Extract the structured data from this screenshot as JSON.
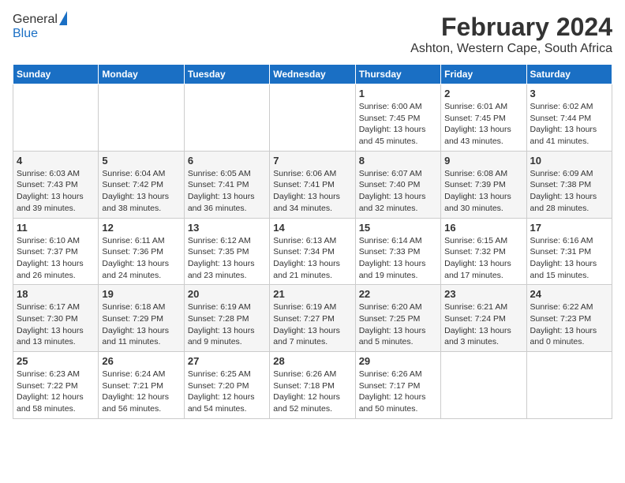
{
  "header": {
    "logo_line1": "General",
    "logo_line2": "Blue",
    "month": "February 2024",
    "location": "Ashton, Western Cape, South Africa"
  },
  "days_of_week": [
    "Sunday",
    "Monday",
    "Tuesday",
    "Wednesday",
    "Thursday",
    "Friday",
    "Saturday"
  ],
  "weeks": [
    [
      {
        "day": "",
        "info": ""
      },
      {
        "day": "",
        "info": ""
      },
      {
        "day": "",
        "info": ""
      },
      {
        "day": "",
        "info": ""
      },
      {
        "day": "1",
        "info": "Sunrise: 6:00 AM\nSunset: 7:45 PM\nDaylight: 13 hours\nand 45 minutes."
      },
      {
        "day": "2",
        "info": "Sunrise: 6:01 AM\nSunset: 7:45 PM\nDaylight: 13 hours\nand 43 minutes."
      },
      {
        "day": "3",
        "info": "Sunrise: 6:02 AM\nSunset: 7:44 PM\nDaylight: 13 hours\nand 41 minutes."
      }
    ],
    [
      {
        "day": "4",
        "info": "Sunrise: 6:03 AM\nSunset: 7:43 PM\nDaylight: 13 hours\nand 39 minutes."
      },
      {
        "day": "5",
        "info": "Sunrise: 6:04 AM\nSunset: 7:42 PM\nDaylight: 13 hours\nand 38 minutes."
      },
      {
        "day": "6",
        "info": "Sunrise: 6:05 AM\nSunset: 7:41 PM\nDaylight: 13 hours\nand 36 minutes."
      },
      {
        "day": "7",
        "info": "Sunrise: 6:06 AM\nSunset: 7:41 PM\nDaylight: 13 hours\nand 34 minutes."
      },
      {
        "day": "8",
        "info": "Sunrise: 6:07 AM\nSunset: 7:40 PM\nDaylight: 13 hours\nand 32 minutes."
      },
      {
        "day": "9",
        "info": "Sunrise: 6:08 AM\nSunset: 7:39 PM\nDaylight: 13 hours\nand 30 minutes."
      },
      {
        "day": "10",
        "info": "Sunrise: 6:09 AM\nSunset: 7:38 PM\nDaylight: 13 hours\nand 28 minutes."
      }
    ],
    [
      {
        "day": "11",
        "info": "Sunrise: 6:10 AM\nSunset: 7:37 PM\nDaylight: 13 hours\nand 26 minutes."
      },
      {
        "day": "12",
        "info": "Sunrise: 6:11 AM\nSunset: 7:36 PM\nDaylight: 13 hours\nand 24 minutes."
      },
      {
        "day": "13",
        "info": "Sunrise: 6:12 AM\nSunset: 7:35 PM\nDaylight: 13 hours\nand 23 minutes."
      },
      {
        "day": "14",
        "info": "Sunrise: 6:13 AM\nSunset: 7:34 PM\nDaylight: 13 hours\nand 21 minutes."
      },
      {
        "day": "15",
        "info": "Sunrise: 6:14 AM\nSunset: 7:33 PM\nDaylight: 13 hours\nand 19 minutes."
      },
      {
        "day": "16",
        "info": "Sunrise: 6:15 AM\nSunset: 7:32 PM\nDaylight: 13 hours\nand 17 minutes."
      },
      {
        "day": "17",
        "info": "Sunrise: 6:16 AM\nSunset: 7:31 PM\nDaylight: 13 hours\nand 15 minutes."
      }
    ],
    [
      {
        "day": "18",
        "info": "Sunrise: 6:17 AM\nSunset: 7:30 PM\nDaylight: 13 hours\nand 13 minutes."
      },
      {
        "day": "19",
        "info": "Sunrise: 6:18 AM\nSunset: 7:29 PM\nDaylight: 13 hours\nand 11 minutes."
      },
      {
        "day": "20",
        "info": "Sunrise: 6:19 AM\nSunset: 7:28 PM\nDaylight: 13 hours\nand 9 minutes."
      },
      {
        "day": "21",
        "info": "Sunrise: 6:19 AM\nSunset: 7:27 PM\nDaylight: 13 hours\nand 7 minutes."
      },
      {
        "day": "22",
        "info": "Sunrise: 6:20 AM\nSunset: 7:25 PM\nDaylight: 13 hours\nand 5 minutes."
      },
      {
        "day": "23",
        "info": "Sunrise: 6:21 AM\nSunset: 7:24 PM\nDaylight: 13 hours\nand 3 minutes."
      },
      {
        "day": "24",
        "info": "Sunrise: 6:22 AM\nSunset: 7:23 PM\nDaylight: 13 hours\nand 0 minutes."
      }
    ],
    [
      {
        "day": "25",
        "info": "Sunrise: 6:23 AM\nSunset: 7:22 PM\nDaylight: 12 hours\nand 58 minutes."
      },
      {
        "day": "26",
        "info": "Sunrise: 6:24 AM\nSunset: 7:21 PM\nDaylight: 12 hours\nand 56 minutes."
      },
      {
        "day": "27",
        "info": "Sunrise: 6:25 AM\nSunset: 7:20 PM\nDaylight: 12 hours\nand 54 minutes."
      },
      {
        "day": "28",
        "info": "Sunrise: 6:26 AM\nSunset: 7:18 PM\nDaylight: 12 hours\nand 52 minutes."
      },
      {
        "day": "29",
        "info": "Sunrise: 6:26 AM\nSunset: 7:17 PM\nDaylight: 12 hours\nand 50 minutes."
      },
      {
        "day": "",
        "info": ""
      },
      {
        "day": "",
        "info": ""
      }
    ]
  ]
}
